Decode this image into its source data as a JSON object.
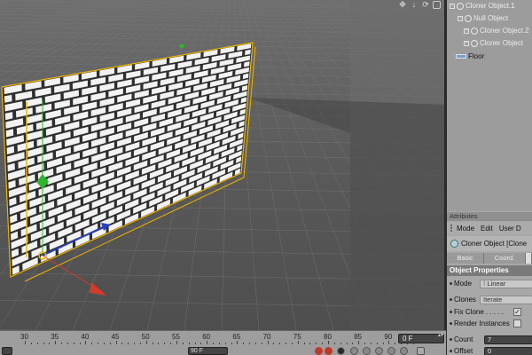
{
  "viewport": {
    "icons": [
      "move-view-icon",
      "arrow-down-icon",
      "rotate-view-icon",
      "maximize-view-icon"
    ],
    "icon_glyphs": [
      "✥",
      "↓",
      "⟳",
      ""
    ]
  },
  "objects": {
    "items": [
      {
        "label": "Cloner Object.1",
        "name": "cloner-object-1"
      },
      {
        "label": "Null Object",
        "name": "null-object"
      },
      {
        "label": "Cloner Object.2",
        "name": "cloner-object-2"
      },
      {
        "label": "Cloner Object",
        "name": "cloner-object"
      },
      {
        "label": "Floor",
        "name": "floor"
      }
    ]
  },
  "attributes": {
    "header": "Attributes",
    "menu": [
      "Mode",
      "Edit",
      "User D"
    ],
    "object_title": "Cloner Object [Clone",
    "tabs": [
      "Basic",
      "Coord.",
      ""
    ],
    "section": "Object Properties",
    "props": {
      "mode_label": "Mode",
      "mode_value": "Linear",
      "clones_label": "Clones",
      "clones_value": "Iterate",
      "fix_clone_label": "Fix Clone . . . . .",
      "fix_clone_checked": "✓",
      "render_instances_label": "Render Instances",
      "count_label": "Count",
      "count_value": "7",
      "offset_label": "Offset",
      "offset_value": "0"
    }
  },
  "timeline": {
    "ticks": [
      "30",
      "35",
      "40",
      "45",
      "50",
      "55",
      "60",
      "65",
      "70",
      "75",
      "80",
      "85",
      "90"
    ],
    "frame": "0 F",
    "fps_field": "90 F"
  },
  "colors": {
    "wall_fill": "#f2f2f2",
    "wall_line": "#2e2e2e",
    "selection": "#f0b400",
    "axis_x": "#d43b2a",
    "axis_y": "#2bb52b",
    "axis_z": "#2a3fbf"
  }
}
